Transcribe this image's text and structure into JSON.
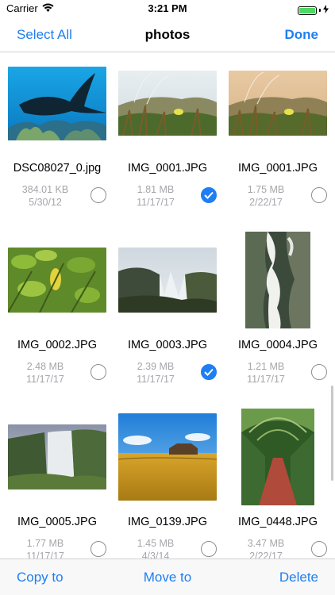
{
  "status_bar": {
    "carrier": "Carrier",
    "time": "3:21 PM"
  },
  "nav": {
    "left_button": "Select All",
    "title": "photos",
    "right_button": "Done"
  },
  "items": [
    {
      "filename": "DSC08027_0.jpg",
      "size": "384.01 KB",
      "date": "5/30/12",
      "selected": false
    },
    {
      "filename": "IMG_0001.JPG",
      "size": "1.81 MB",
      "date": "11/17/17",
      "selected": true
    },
    {
      "filename": "IMG_0001.JPG",
      "size": "1.75 MB",
      "date": "2/22/17",
      "selected": false
    },
    {
      "filename": "IMG_0002.JPG",
      "size": "2.48 MB",
      "date": "11/17/17",
      "selected": false
    },
    {
      "filename": "IMG_0003.JPG",
      "size": "2.39 MB",
      "date": "11/17/17",
      "selected": true
    },
    {
      "filename": "IMG_0004.JPG",
      "size": "1.21 MB",
      "date": "11/17/17",
      "selected": false
    },
    {
      "filename": "IMG_0005.JPG",
      "size": "1.77 MB",
      "date": "11/17/17",
      "selected": false
    },
    {
      "filename": "IMG_0139.JPG",
      "size": "1.45 MB",
      "date": "4/3/14",
      "selected": false
    },
    {
      "filename": "IMG_0448.JPG",
      "size": "3.47 MB",
      "date": "2/22/17",
      "selected": false
    }
  ],
  "toolbar": {
    "copy_label": "Copy to",
    "move_label": "Move to",
    "delete_label": "Delete"
  },
  "colors": {
    "accent": "#1e7ef2",
    "meta_text": "#a6a6ab",
    "battery": "#4cd964"
  }
}
